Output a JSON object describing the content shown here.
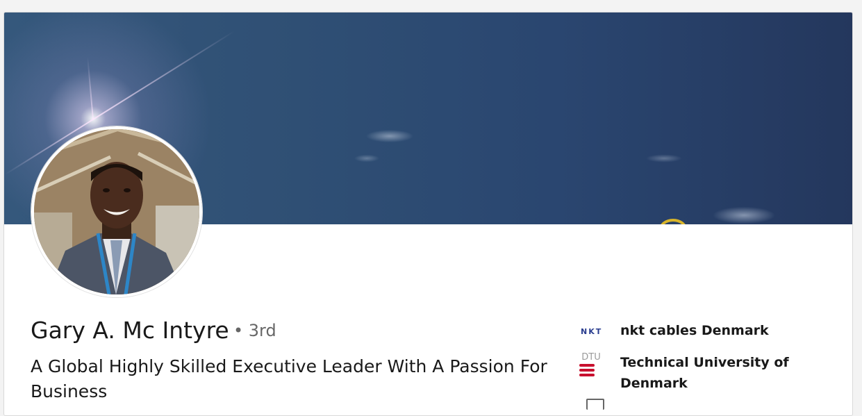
{
  "profile": {
    "name": "Gary A. Mc Intyre",
    "degree": "• 3rd",
    "headline": "A Global Highly Skilled Executive Leader With A Passion For Business"
  },
  "experience": {
    "company": "nkt cables Denmark",
    "logo_text": "NKT"
  },
  "education": {
    "school": "Technical University of Denmark",
    "logo_text": "DTU"
  },
  "colors": {
    "banner_sky": "#2f4f74",
    "dtu_red": "#c8102e",
    "nkt_blue": "#2a3d8f"
  }
}
